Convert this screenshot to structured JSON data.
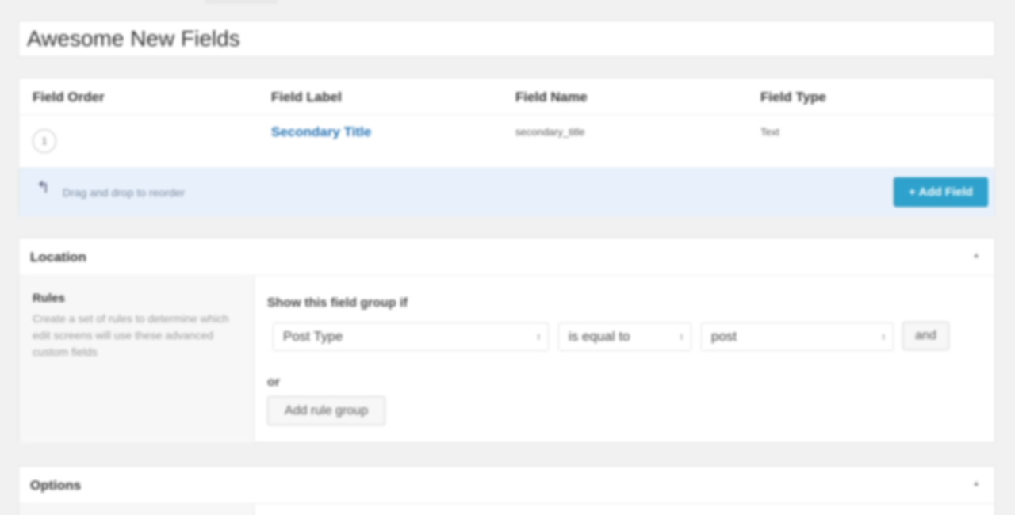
{
  "title": {
    "value": "Awesome New Fields"
  },
  "fields": {
    "columns": [
      "Field Order",
      "Field Label",
      "Field Name",
      "Field Type"
    ],
    "rows": [
      {
        "order": "1",
        "label": "Secondary Title",
        "name": "secondary_title",
        "type": "Text"
      }
    ],
    "drag_text": "Drag and drop to reorder",
    "add_button": "+ Add Field"
  },
  "location": {
    "heading": "Location",
    "rules_title": "Rules",
    "rules_desc": "Create a set of rules to determine which edit screens will use these advanced custom fields",
    "show_label": "Show this field group if",
    "param": "Post Type",
    "operator": "is equal to",
    "value": "post",
    "and_button": "and",
    "or_label": "or",
    "add_rule_group": "Add rule group"
  },
  "options": {
    "heading": "Options"
  },
  "colors": {
    "accent": "#2ea2cc",
    "link": "#2271b1",
    "footer_bg": "#e8f0fb"
  }
}
